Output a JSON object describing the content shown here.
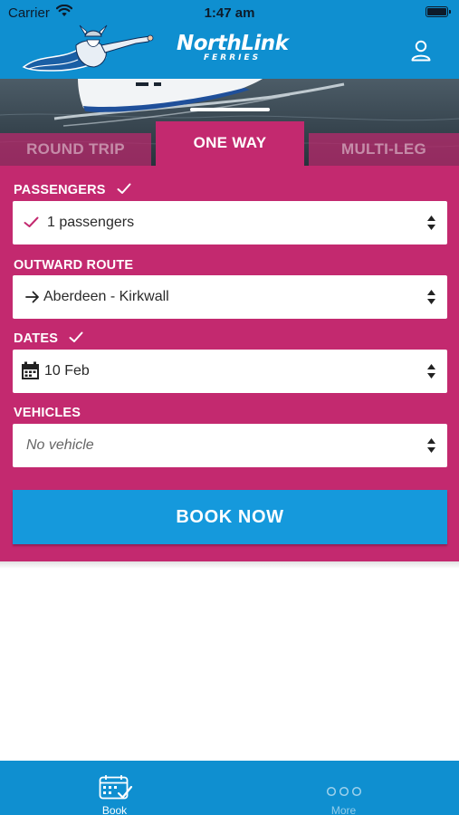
{
  "status_bar": {
    "carrier": "Carrier",
    "time": "1:47 am"
  },
  "header": {
    "brand_name": "NorthLink",
    "brand_sub": "FERRIES",
    "profile_icon": "person-icon",
    "logo_icon": "viking-logo-icon"
  },
  "tabs": [
    {
      "label": "ROUND TRIP",
      "selected": false
    },
    {
      "label": "ONE WAY",
      "selected": true
    },
    {
      "label": "MULTI-LEG",
      "selected": false
    }
  ],
  "form": {
    "passengers": {
      "label": "PASSENGERS",
      "value": "1 passengers",
      "icon": "checkmark-icon"
    },
    "route": {
      "label": "OUTWARD ROUTE",
      "value": "Aberdeen - Kirkwall",
      "icon": "arrow-right-icon"
    },
    "dates": {
      "label": "DATES",
      "value": "10 Feb",
      "icon": "calendar-icon"
    },
    "vehicles": {
      "label": "VEHICLES",
      "placeholder": "No vehicle"
    },
    "book_label": "BOOK NOW"
  },
  "tabbar": [
    {
      "label": "Book",
      "icon": "calendar-check-icon",
      "selected": true
    },
    {
      "label": "More",
      "icon": "more-dots-icon",
      "selected": false
    }
  ],
  "colors": {
    "header_blue": "#0f8fd0",
    "panel_pink": "#c3296f",
    "button_blue": "#1599dc"
  }
}
